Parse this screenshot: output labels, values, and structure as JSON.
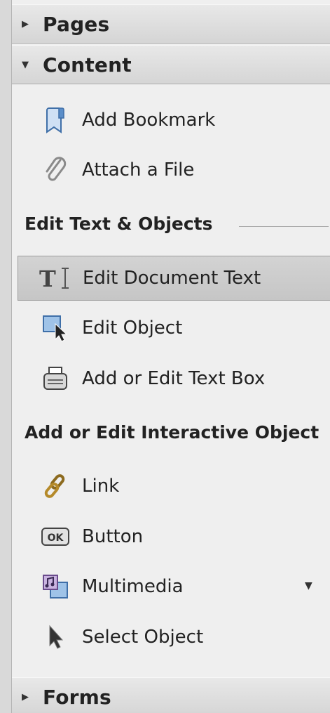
{
  "sections": {
    "pages": {
      "label": "Pages",
      "expanded": false
    },
    "content": {
      "label": "Content",
      "expanded": true
    },
    "forms": {
      "label": "Forms",
      "expanded": false
    }
  },
  "content": {
    "items": [
      {
        "label": "Add Bookmark",
        "icon": "bookmark-icon"
      },
      {
        "label": "Attach a File",
        "icon": "paperclip-icon"
      }
    ],
    "edit_group": {
      "heading": "Edit Text & Objects",
      "items": [
        {
          "label": "Edit Document Text",
          "icon": "text-cursor-icon",
          "selected": true
        },
        {
          "label": "Edit Object",
          "icon": "object-select-icon"
        },
        {
          "label": "Add or Edit Text Box",
          "icon": "typewriter-icon"
        }
      ]
    },
    "interactive_group": {
      "heading": "Add or Edit Interactive Object",
      "items": [
        {
          "label": "Link",
          "icon": "link-icon"
        },
        {
          "label": "Button",
          "icon": "ok-button-icon",
          "icon_text": "OK"
        },
        {
          "label": "Multimedia",
          "icon": "multimedia-icon",
          "has_dropdown": true
        },
        {
          "label": "Select Object",
          "icon": "pointer-arrow-icon"
        }
      ]
    }
  },
  "colors": {
    "panel_bg": "#efefef",
    "header_bg": "#dcdcdc",
    "selected_bg": "#cccccc",
    "bookmark_blue": "#5b8ec9"
  }
}
